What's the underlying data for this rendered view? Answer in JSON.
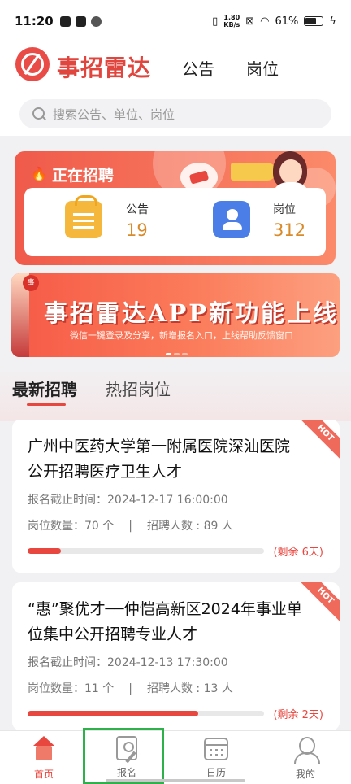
{
  "status_bar": {
    "time": "11:20",
    "net_speed_value": "1.80",
    "net_speed_unit": "KB/s",
    "battery": "61%"
  },
  "header": {
    "app_title": "事招雷达",
    "nav_tabs": [
      "公告",
      "岗位"
    ],
    "search_placeholder": "搜索公告、单位、岗位"
  },
  "hiring": {
    "title": "正在招聘",
    "stats": [
      {
        "label": "公告",
        "value": "19",
        "icon": "notice-board-icon"
      },
      {
        "label": "岗位",
        "value": "312",
        "icon": "position-card-icon"
      }
    ]
  },
  "banner": {
    "badge": "事",
    "headline": "事招雷达APP新功能上线",
    "subtitle": "微信一键登录及分享，新增报名入口，上线帮助反馈窗口"
  },
  "section_tabs": [
    "最新招聘",
    "热招岗位"
  ],
  "jobs": [
    {
      "title": "广州中医药大学第一附属医院深汕医院公开招聘医疗卫生人才",
      "deadline": "报名截止时间：2024-12-17 16:00:00",
      "positions": "岗位数量：70 个",
      "separator": "|",
      "hires": "招聘人数 : 89 人",
      "remaining": "(剩余 6天)",
      "progress": 0.14,
      "hot_label": "HOT"
    },
    {
      "title": "“惠”聚优才──仲恺高新区2024年事业单位集中公开招聘专业人才",
      "deadline": "报名截止时间：2024-12-13 17:30:00",
      "positions": "岗位数量：11 个",
      "separator": "|",
      "hires": "招聘人数 : 13 人",
      "remaining": "(剩余 2天)",
      "progress": 0.72,
      "hot_label": "HOT"
    }
  ],
  "bottom_nav": [
    {
      "label": "首页",
      "icon": "home-icon",
      "active": true
    },
    {
      "label": "报名",
      "icon": "signup-icon",
      "active": false
    },
    {
      "label": "日历",
      "icon": "calendar-icon",
      "active": false
    },
    {
      "label": "我的",
      "icon": "profile-icon",
      "active": false
    }
  ],
  "colors": {
    "brand": "#e8473f",
    "stat_value": "#d98a2a",
    "highlight": "#2eb04a"
  }
}
